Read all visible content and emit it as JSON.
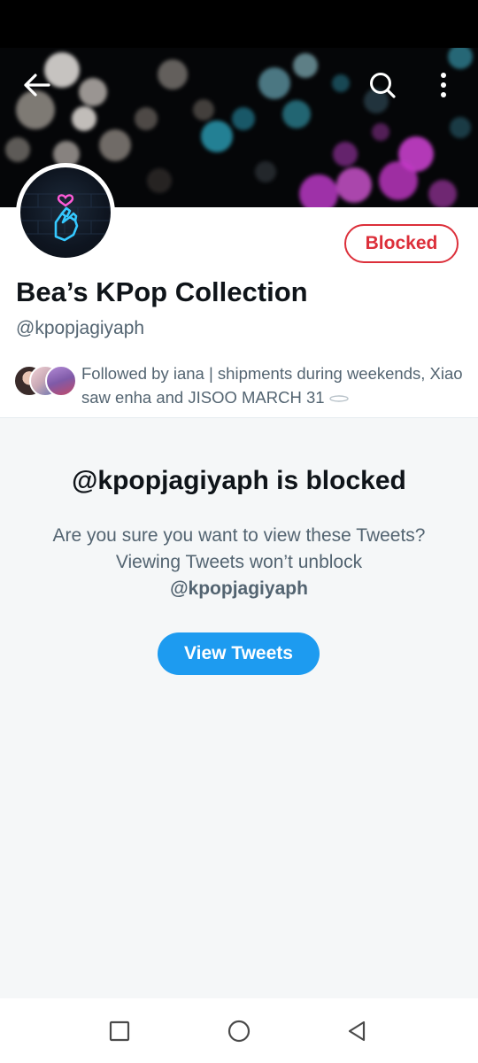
{
  "header": {
    "back_icon": "arrow-left-icon",
    "search_icon": "search-icon",
    "more_icon": "more-vertical-icon"
  },
  "profile": {
    "display_name": "Bea’s KPop Collection",
    "handle": "@kpopjagiyaph",
    "blocked_label": "Blocked",
    "followed_by": "Followed by iana | shipments during weekends, Xiao saw enha and JISOO MARCH 31",
    "avatar_icon": "heart-finger-neon-icon"
  },
  "blocked_notice": {
    "title": "@kpopjagiyaph is blocked",
    "message": "Are you sure you want to view these Tweets? Viewing Tweets won’t unblock",
    "message_handle": "@kpopjagiyaph",
    "button_label": "View Tweets"
  },
  "system_nav": {
    "recents_icon": "square-icon",
    "home_icon": "circle-icon",
    "back_icon": "triangle-back-icon"
  },
  "colors": {
    "accent": "#1d9bf0",
    "blocked": "#dc2f3a",
    "secondary_text": "#536471",
    "panel_bg": "#f5f7f8"
  }
}
